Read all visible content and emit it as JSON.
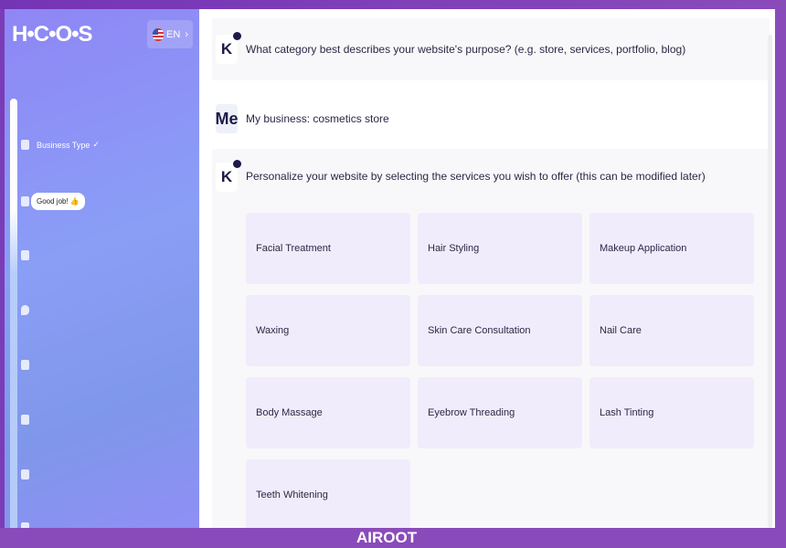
{
  "sidebar": {
    "logo": "H•C•O•S",
    "language": "EN",
    "steps": [
      {
        "label": "Business Type",
        "check": "✓"
      }
    ],
    "bubble": "Good job! 👍",
    "icons": [
      "clipboard-icon",
      "list-icon",
      "grid-icon",
      "location-icon",
      "tag-icon",
      "heart-icon",
      "mail-icon",
      "folder-icon"
    ]
  },
  "chat": {
    "bot_avatar": "K",
    "user_avatar": "Me",
    "q1": "What category best describes your website's purpose? (e.g. store, services, portfolio, blog)",
    "a1": "My business: cosmetics store",
    "q2": "Personalize your website by selecting the services you wish to offer (this can be modified later)",
    "services": [
      "Facial Treatment",
      "Hair Styling",
      "Makeup Application",
      "Waxing",
      "Skin Care Consultation",
      "Nail Care",
      "Body Massage",
      "Eyebrow Threading",
      "Lash Tinting",
      "Teeth Whitening"
    ]
  },
  "watermark": "AIROOT",
  "colors": {
    "frame": "#8a4bba",
    "card": "#f1ecfb",
    "text": "#2a2845"
  }
}
